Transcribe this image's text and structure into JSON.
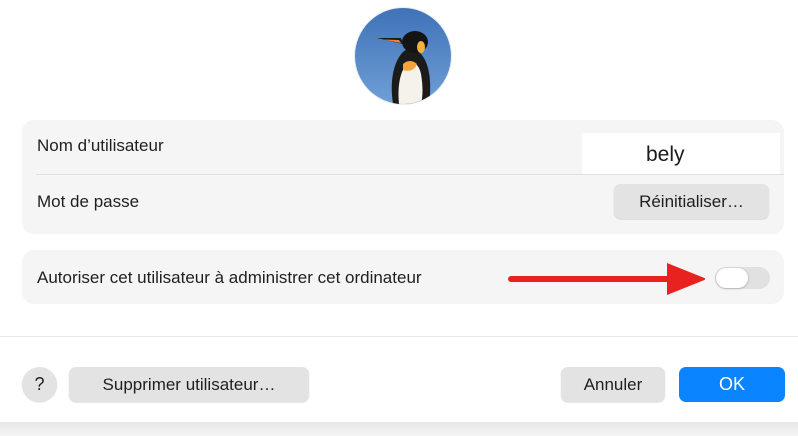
{
  "account": {
    "username_label": "Nom d’utilisateur",
    "username_value": "bely",
    "password_label": "Mot de passe",
    "reset_button": "Réinitialiser…"
  },
  "admin": {
    "label": "Autoriser cet utilisateur à administrer cet ordinateur",
    "toggle_on": false
  },
  "footer": {
    "help_label": "?",
    "delete_button": "Supprimer utilisateur…",
    "cancel_button": "Annuler",
    "ok_button": "OK"
  },
  "colors": {
    "accent": "#0a84ff",
    "annotation_arrow": "#e8231f"
  }
}
